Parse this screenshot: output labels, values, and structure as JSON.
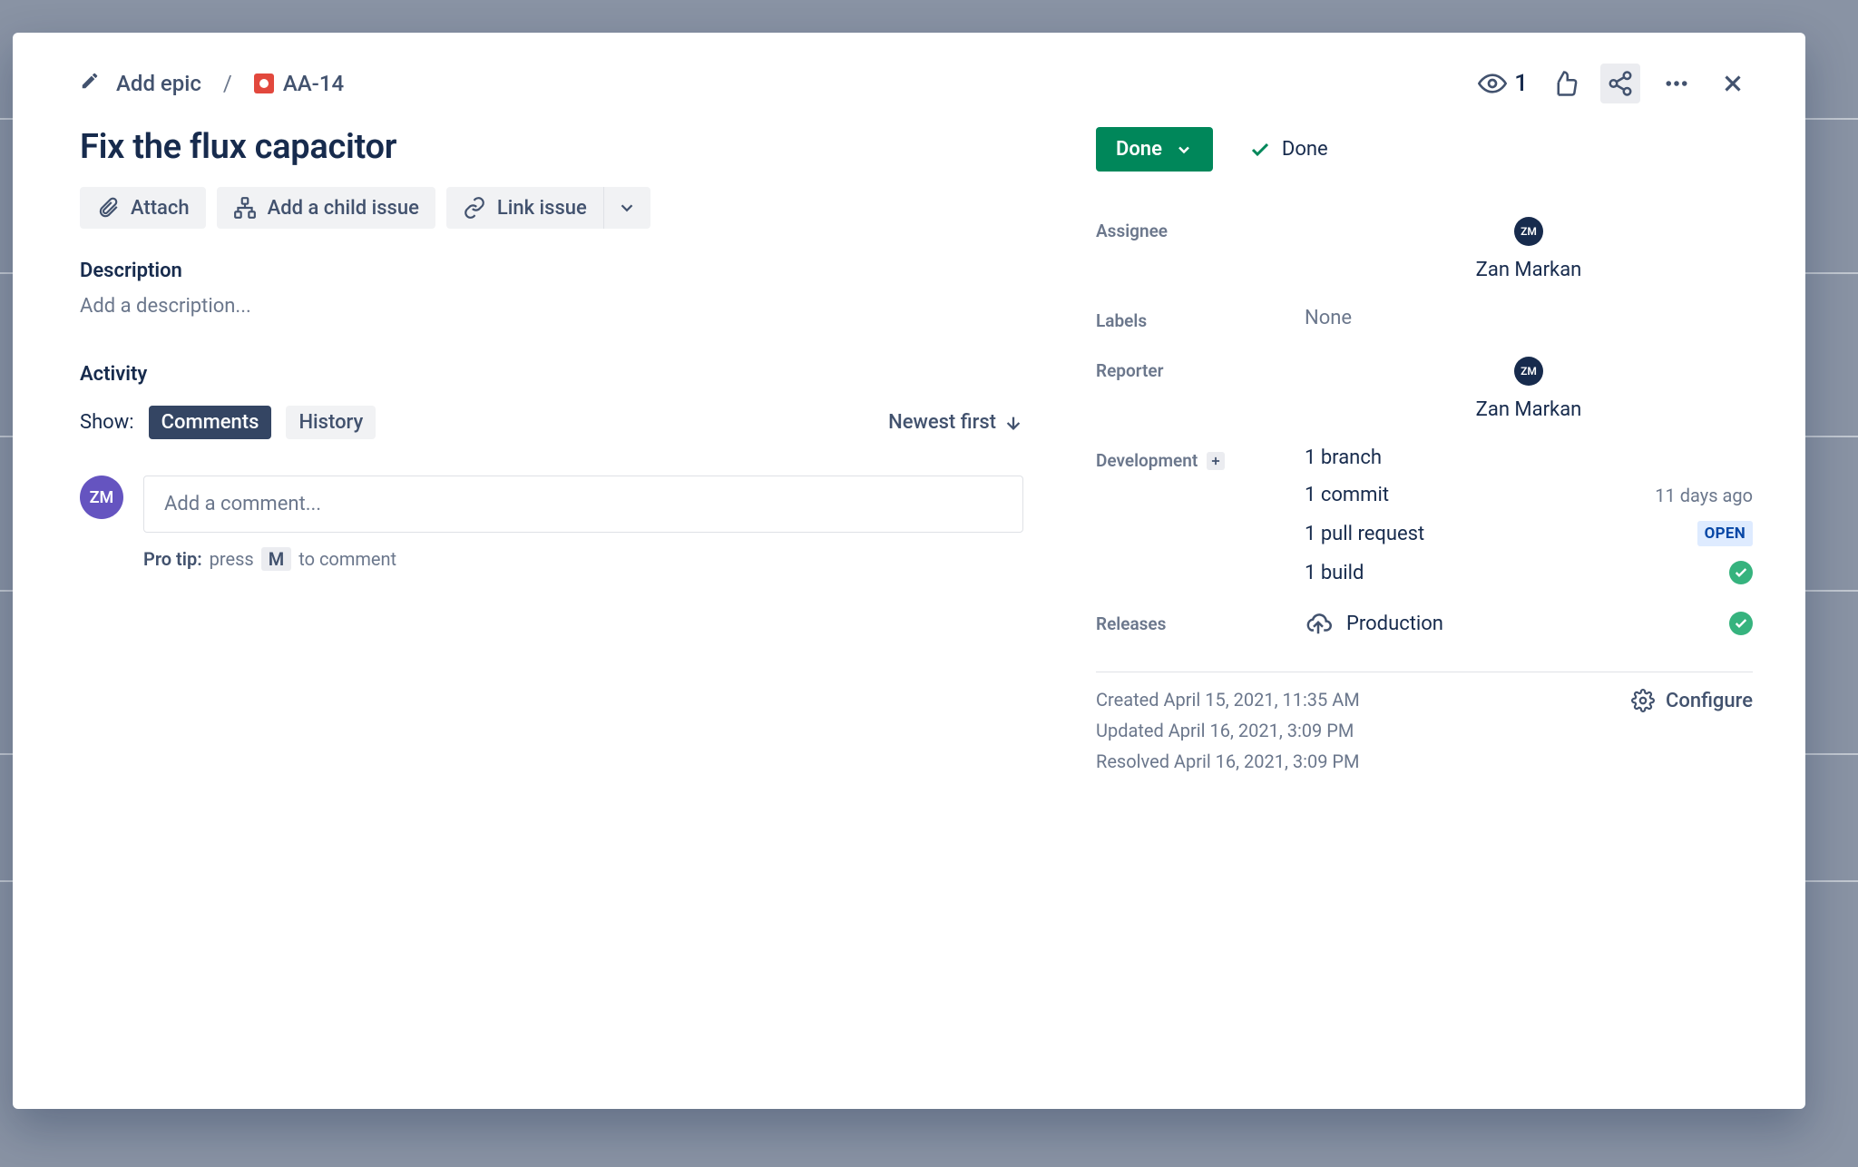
{
  "breadcrumb": {
    "add_epic": "Add epic",
    "issue_key": "AA-14"
  },
  "header_actions": {
    "watchers": "1"
  },
  "issue": {
    "title": "Fix the flux capacitor"
  },
  "actions": {
    "attach": "Attach",
    "add_child": "Add a child issue",
    "link": "Link issue"
  },
  "description": {
    "label": "Description",
    "placeholder": "Add a description..."
  },
  "activity": {
    "label": "Activity",
    "show": "Show:",
    "tab_comments": "Comments",
    "tab_history": "History",
    "sort": "Newest first",
    "comment_placeholder": "Add a comment...",
    "protip_label": "Pro tip:",
    "protip_prefix": "press",
    "protip_key": "M",
    "protip_suffix": "to comment",
    "avatar_initials": "ZM"
  },
  "status": {
    "button": "Done",
    "resolution": "Done"
  },
  "fields": {
    "assignee_label": "Assignee",
    "assignee_value": "Zan Markan",
    "assignee_initials": "ZM",
    "labels_label": "Labels",
    "labels_value": "None",
    "reporter_label": "Reporter",
    "reporter_value": "Zan Markan",
    "reporter_initials": "ZM",
    "development_label": "Development",
    "dev_branch": "1 branch",
    "dev_commit": "1 commit",
    "dev_commit_time": "11 days ago",
    "dev_pr": "1 pull request",
    "dev_pr_status": "OPEN",
    "dev_build": "1 build",
    "releases_label": "Releases",
    "releases_value": "Production"
  },
  "meta": {
    "created": "Created April 15, 2021, 11:35 AM",
    "updated": "Updated April 16, 2021, 3:09 PM",
    "resolved": "Resolved April 16, 2021, 3:09 PM",
    "configure": "Configure"
  }
}
